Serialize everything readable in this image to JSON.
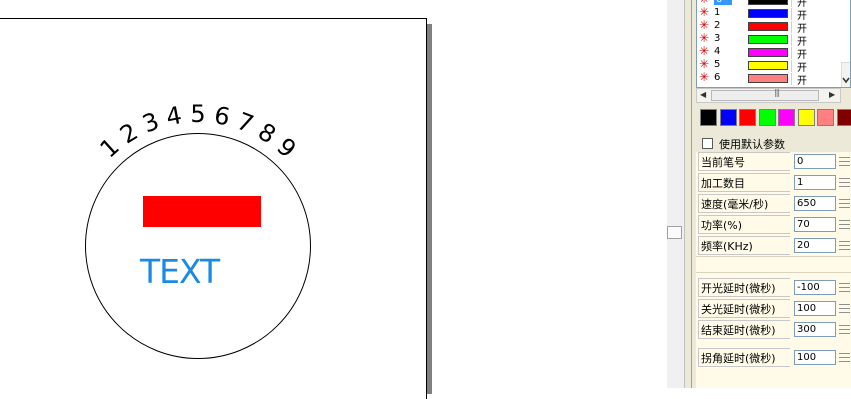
{
  "canvas": {
    "arc_text": "123456789",
    "text_object": "TEXT",
    "colors": {
      "rectangle": "#ff0000",
      "text_object": "#1a8ae6",
      "arc_text": "#000000"
    }
  },
  "pens": {
    "rows": [
      {
        "number": "0",
        "color": "#000000",
        "state": "开"
      },
      {
        "number": "1",
        "color": "#0000ff",
        "state": "开"
      },
      {
        "number": "2",
        "color": "#ff0000",
        "state": "开"
      },
      {
        "number": "3",
        "color": "#00ff00",
        "state": "开"
      },
      {
        "number": "4",
        "color": "#ff00ff",
        "state": "开"
      },
      {
        "number": "5",
        "color": "#ffff00",
        "state": "开"
      },
      {
        "number": "6",
        "color": "#ff8080",
        "state": "开"
      }
    ],
    "row_marker_icon": "asterisk-icon"
  },
  "scrollbar": {
    "grip": "|||",
    "left_icon": "arrow-left-icon",
    "right_icon": "arrow-right-icon"
  },
  "palette": [
    "#000000",
    "#0000ff",
    "#ff0000",
    "#00ff00",
    "#ff00ff",
    "#ffff00",
    "#ff8080",
    "#800000"
  ],
  "default_params": {
    "label": "使用默认参数",
    "checked": false
  },
  "params": [
    {
      "label": "当前笔号",
      "value": "0"
    },
    {
      "label": "加工数目",
      "value": "1"
    },
    {
      "label": "速度(毫米/秒)",
      "value": "650"
    },
    {
      "label": "功率(%)",
      "value": "70"
    },
    {
      "label": "频率(KHz)",
      "value": "20"
    },
    {
      "label": "开光延时(微秒)",
      "value": "-100"
    },
    {
      "label": "关光延时(微秒)",
      "value": "100"
    },
    {
      "label": "结束延时(微秒)",
      "value": "300"
    },
    {
      "label": "拐角延时(微秒)",
      "value": "100"
    }
  ]
}
